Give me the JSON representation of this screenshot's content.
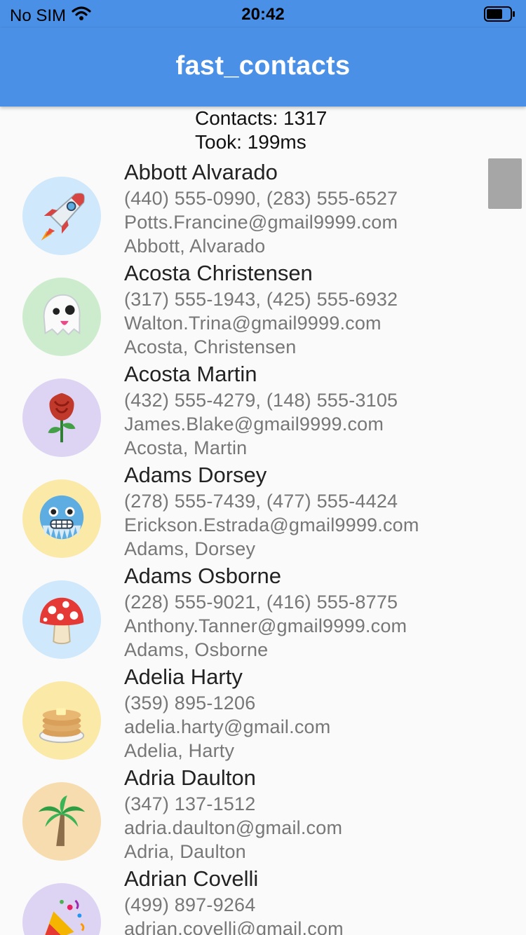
{
  "status_bar": {
    "carrier": "No SIM",
    "time": "20:42"
  },
  "app_bar": {
    "title": "fast_contacts"
  },
  "summary": {
    "contacts": "Contacts: 1317",
    "took": "Took: 199ms"
  },
  "contacts": [
    {
      "name": "Abbott Alvarado",
      "phones": "(440) 555-0990, (283) 555-6527",
      "email": "Potts.Francine@gmail9999.com",
      "structured": "Abbott, Alvarado",
      "avatar_icon": "rocket-icon",
      "avatar_bg": "#cfe8fb"
    },
    {
      "name": "Acosta Christensen",
      "phones": "(317) 555-1943, (425) 555-6932",
      "email": "Walton.Trina@gmail9999.com",
      "structured": "Acosta, Christensen",
      "avatar_icon": "ghost-icon",
      "avatar_bg": "#cdeccd"
    },
    {
      "name": "Acosta Martin",
      "phones": "(432) 555-4279, (148) 555-3105",
      "email": "James.Blake@gmail9999.com",
      "structured": "Acosta, Martin",
      "avatar_icon": "rose-icon",
      "avatar_bg": "#ddd3f3"
    },
    {
      "name": "Adams Dorsey",
      "phones": "(278) 555-7439, (477) 555-4424",
      "email": "Erickson.Estrada@gmail9999.com",
      "structured": "Adams, Dorsey",
      "avatar_icon": "cold-face-icon",
      "avatar_bg": "#fbe9a8"
    },
    {
      "name": "Adams Osborne",
      "phones": "(228) 555-9021, (416) 555-8775",
      "email": "Anthony.Tanner@gmail9999.com",
      "structured": "Adams, Osborne",
      "avatar_icon": "mushroom-icon",
      "avatar_bg": "#cfe8fb"
    },
    {
      "name": "Adelia Harty",
      "phones": "(359) 895-1206",
      "email": "adelia.harty@gmail.com",
      "structured": "Adelia, Harty",
      "avatar_icon": "pancakes-icon",
      "avatar_bg": "#fbe9a8"
    },
    {
      "name": "Adria Daulton",
      "phones": "(347) 137-1512",
      "email": "adria.daulton@gmail.com",
      "structured": "Adria, Daulton",
      "avatar_icon": "palm-tree-icon",
      "avatar_bg": "#f6dcae"
    },
    {
      "name": "Adrian Covelli",
      "phones": "(499) 897-9264",
      "email": "adrian.covelli@gmail.com",
      "structured": "",
      "avatar_icon": "party-popper-icon",
      "avatar_bg": "#ddd3f3"
    }
  ],
  "colors": {
    "primary": "#4a90e6",
    "background": "#fafafa",
    "subtitle": "#777777"
  }
}
